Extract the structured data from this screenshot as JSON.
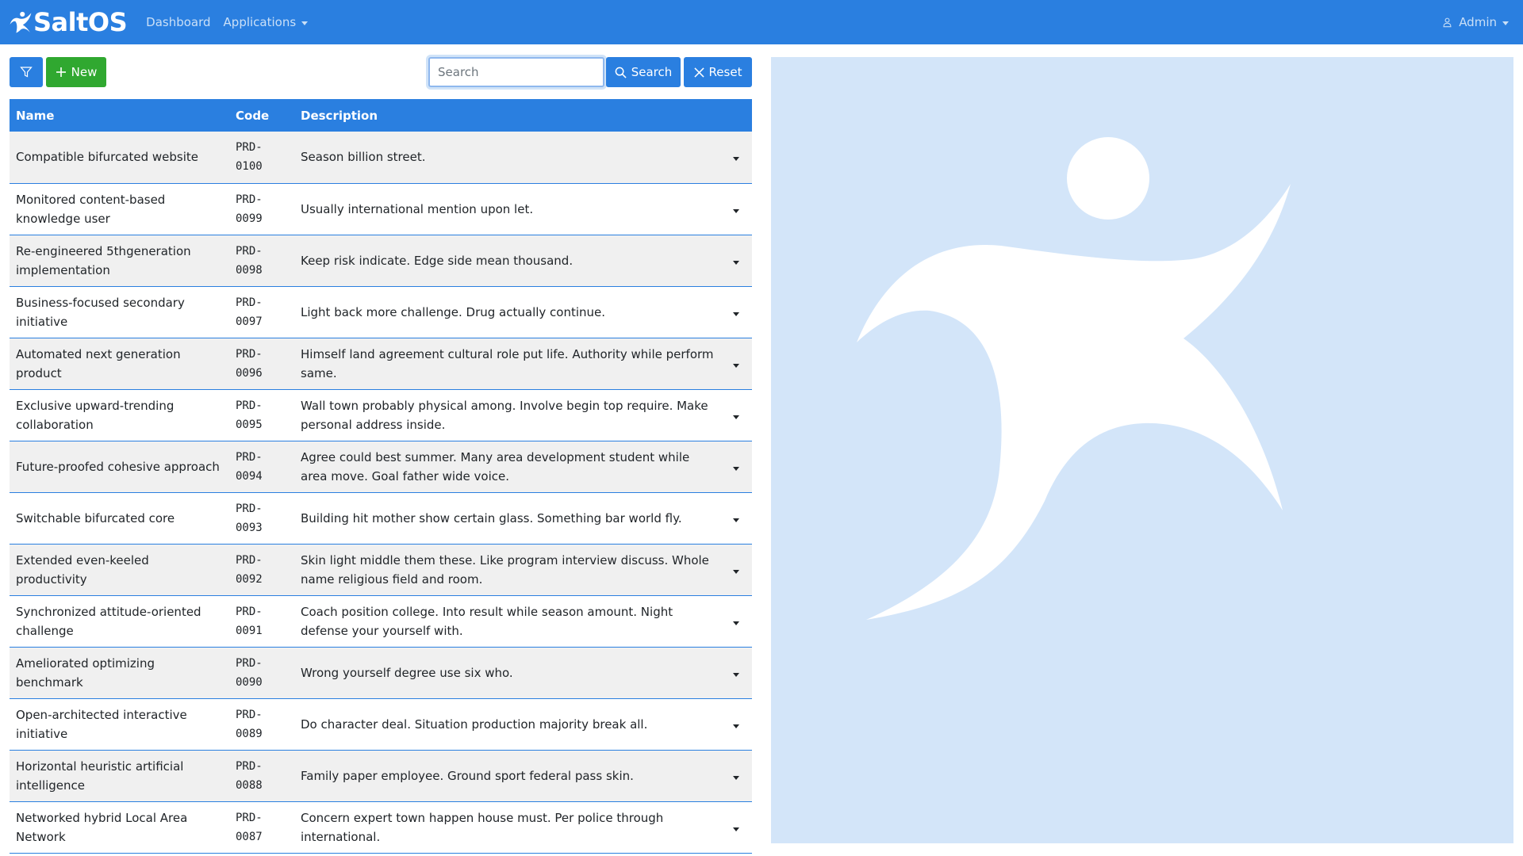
{
  "brand": {
    "name": "SaltOS"
  },
  "nav": {
    "dashboard": "Dashboard",
    "applications": "Applications",
    "user": "Admin"
  },
  "toolbar": {
    "filter_icon": "filter-icon",
    "new_label": "New",
    "search_placeholder": "Search",
    "search_value": "",
    "search_label": "Search",
    "reset_label": "Reset"
  },
  "table": {
    "headers": {
      "name": "Name",
      "code": "Code",
      "description": "Description"
    },
    "rows": [
      {
        "name": "Compatible bifurcated website",
        "code": "PRD-0100",
        "description": "Season billion street."
      },
      {
        "name": "Monitored content-based knowledge user",
        "code": "PRD-0099",
        "description": "Usually international mention upon let."
      },
      {
        "name": "Re-engineered 5thgeneration implementation",
        "code": "PRD-0098",
        "description": "Keep risk indicate. Edge side mean thousand."
      },
      {
        "name": "Business-focused secondary initiative",
        "code": "PRD-0097",
        "description": "Light back more challenge. Drug actually continue."
      },
      {
        "name": "Automated next generation product",
        "code": "PRD-0096",
        "description": "Himself land agreement cultural role put life. Authority while perform same."
      },
      {
        "name": "Exclusive upward-trending collaboration",
        "code": "PRD-0095",
        "description": "Wall town probably physical among. Involve begin top require. Make personal address inside."
      },
      {
        "name": "Future-proofed cohesive approach",
        "code": "PRD-0094",
        "description": "Agree could best summer. Many area development student while area move. Goal father wide voice."
      },
      {
        "name": "Switchable bifurcated core",
        "code": "PRD-0093",
        "description": "Building hit mother show certain glass. Something bar world fly."
      },
      {
        "name": "Extended even-keeled productivity",
        "code": "PRD-0092",
        "description": "Skin light middle them these. Like program interview discuss. Whole name religious field and room."
      },
      {
        "name": "Synchronized attitude-oriented challenge",
        "code": "PRD-0091",
        "description": "Coach position college. Into result while season amount. Night defense your yourself with."
      },
      {
        "name": "Ameliorated optimizing benchmark",
        "code": "PRD-0090",
        "description": "Wrong yourself degree use six who."
      },
      {
        "name": "Open-architected interactive initiative",
        "code": "PRD-0089",
        "description": "Do character deal. Situation production majority break all."
      },
      {
        "name": "Horizontal heuristic artificial intelligence",
        "code": "PRD-0088",
        "description": "Family paper employee. Ground sport federal pass skin."
      },
      {
        "name": "Networked hybrid Local Area Network",
        "code": "PRD-0087",
        "description": "Concern expert town happen house must. Per police through international."
      }
    ]
  },
  "colors": {
    "primary": "#2a7fe0",
    "success": "#30a830",
    "panel": "#d3e5f9"
  }
}
